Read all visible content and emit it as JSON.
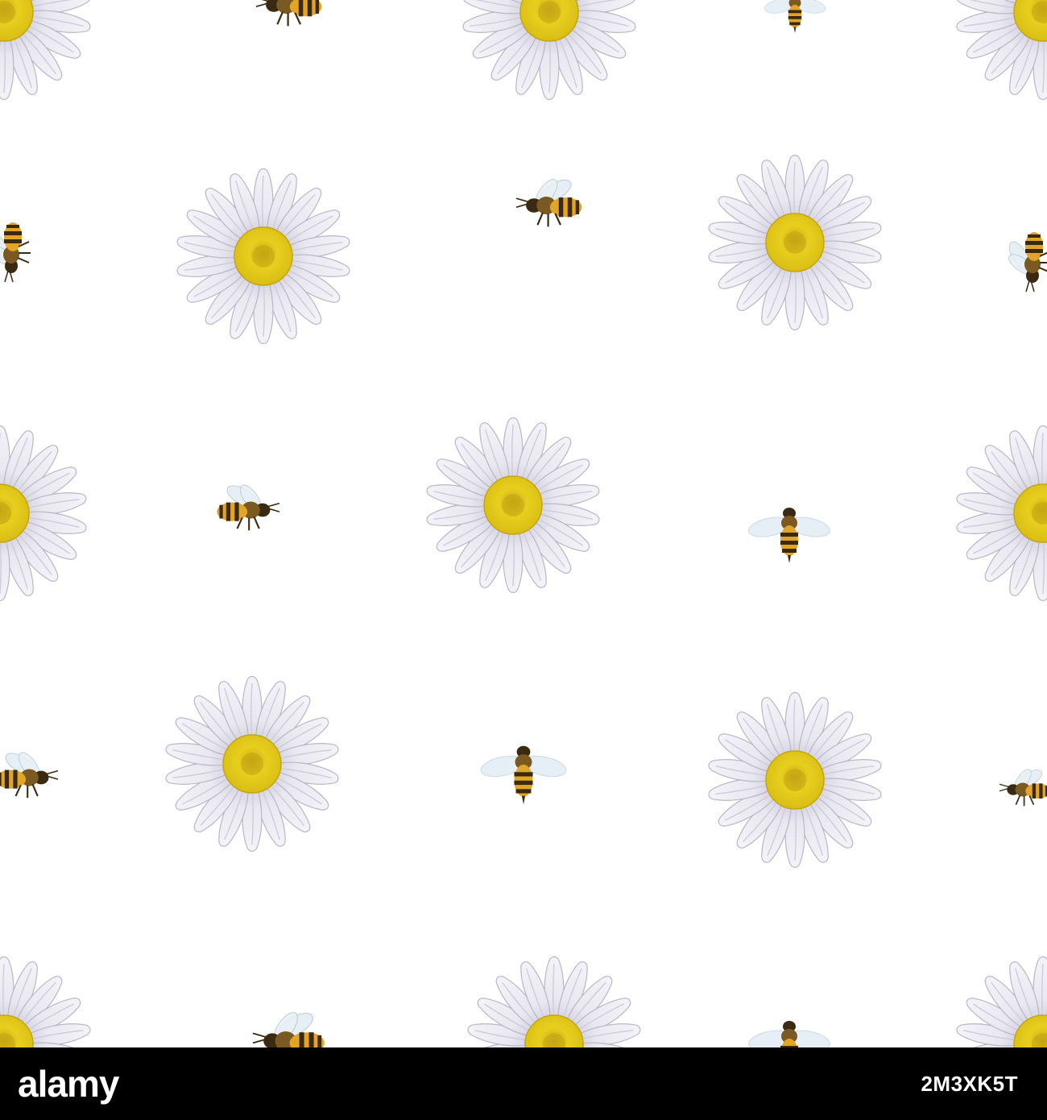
{
  "pattern": {
    "description_colors": {
      "background": "#ffffff",
      "petal": "#f7f6fa",
      "petal_shadow": "#b9b6c8",
      "flower_center": "#e8cf1e",
      "flower_center_dark": "#b79a0c",
      "bee_body": "#3a2a12",
      "bee_stripe": "#e2a526",
      "bee_wing": "#e3eef5"
    },
    "icons": [
      "chamomile-flower-icon",
      "honey-bee-icon"
    ]
  },
  "footer": {
    "brand": "alamy",
    "image_id": "2M3XK5T",
    "background": "#000000",
    "text_color": "#ffffff"
  }
}
